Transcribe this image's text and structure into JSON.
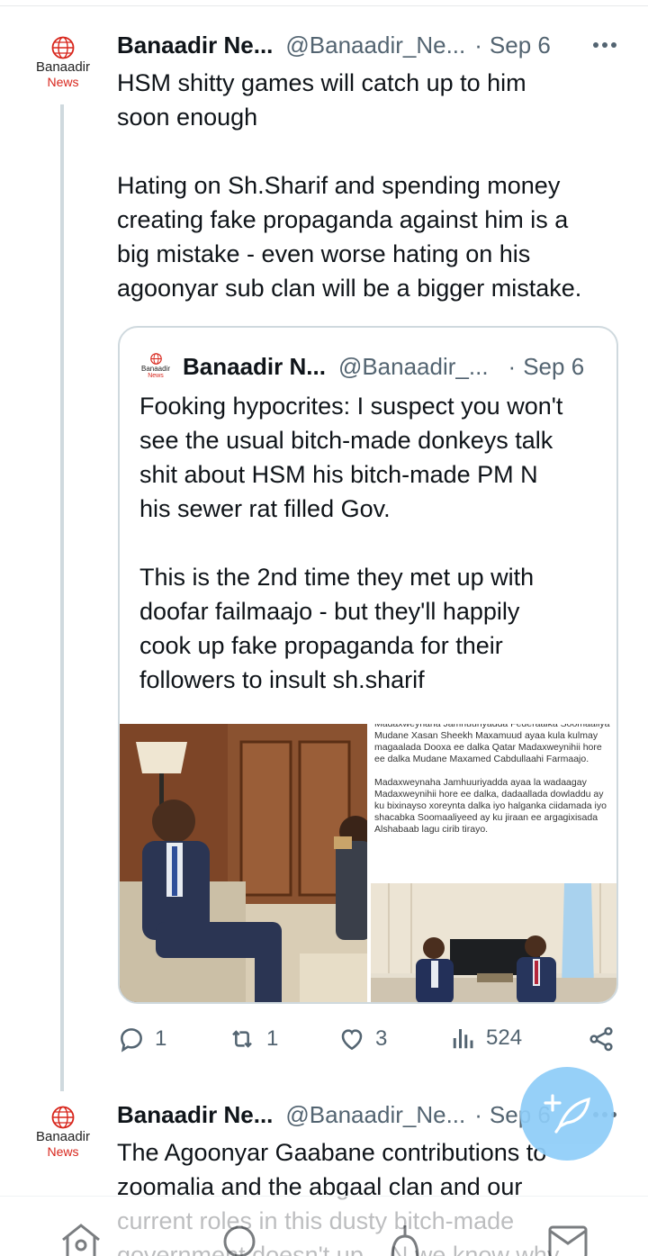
{
  "tweet1": {
    "author_logo_name": "Banaadir",
    "author_logo_sub": "News",
    "name": "Banaadir Ne...",
    "handle": "@Banaadir_Ne...",
    "separator": "·",
    "date": "Sep 6",
    "text_p1": "HSM shitty games will catch up to him\nsoon enough",
    "text_p2": "Hating on Sh.Sharif and spending money\ncreating fake propaganda against him is a\nbig mistake - even worse hating on his\nagoonyar sub clan will be a bigger mistake.",
    "quote": {
      "logo_name": "Banaadir",
      "logo_sub": "News",
      "name": "Banaadir N...",
      "handle": "@Banaadir_...",
      "separator": "·",
      "date": "Sep 6",
      "text_p1": "Fooking hypocrites: I suspect you won't\nsee the usual bitch-made donkeys talk\nshit about HSM his bitch-made PM N\nhis sewer rat filled Gov.",
      "text_p2": "This is the 2nd time they met up with\ndoofar failmaajo - but they'll happily\ncook up fake propaganda for their\nfollowers to insult sh.sharif",
      "media_text_p1": "Madaxweynaha Jamhuuriyadda Federaalka Soomaaliya Mudane Xasan Sheekh Maxamuud ayaa kula kulmay magaalada Dooxa ee dalka Qatar Madaxweynihii hore ee dalka Mudane Maxamed Cabdullaahi Farmaajo.",
      "media_text_p2": "Madaxweynaha Jamhuuriyadda ayaa la wadaagay Madaxweynihii hore ee dalka, dadaallada dowladdu ay ku bixinayso xoreynta dalka iyo halganka ciidamada iyo shacabka Soomaaliyeed ay ku jiraan ee argagixisada Alshabaab lagu cirib tirayo."
    },
    "actions": {
      "replies": "1",
      "reposts": "1",
      "likes": "3",
      "views": "524"
    }
  },
  "tweet2": {
    "author_logo_name": "Banaadir",
    "author_logo_sub": "News",
    "name": "Banaadir Ne...",
    "handle": "@Banaadir_Ne...",
    "separator": "·",
    "date": "Sep 6",
    "text": "The Agoonyar Gaabane contributions to\nzoomalia and the abgaal clan and our\ncurrent roles in this dusty bitch-made\ngovernment doesn't up... N we know why"
  },
  "colors": {
    "accent": "#1d9bf0",
    "fab": "#8ecdf8",
    "secondary_text": "#536471",
    "logo_red": "#d8261c"
  }
}
